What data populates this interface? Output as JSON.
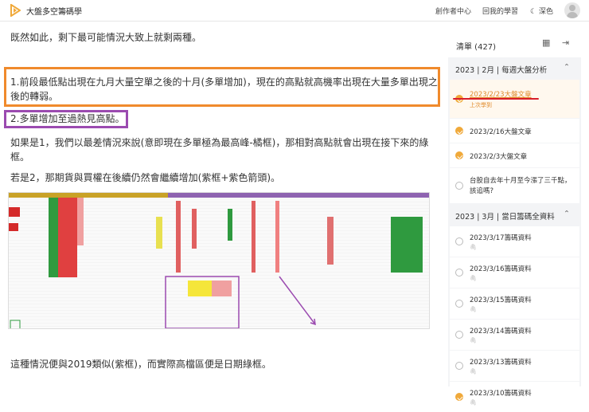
{
  "header": {
    "brand": "大盤多空籌碼學",
    "nav": [
      "創作者中心",
      "回我的學習"
    ],
    "theme_label": "深色",
    "colors": {
      "brand": "#f0a93a"
    }
  },
  "main": {
    "p1": "既然如此，剩下最可能情況大致上就剩兩種。",
    "box1": "1.前段最低點出現在九月大量空單之後的十月(多單增加)，現在的高點就高機率出現在大量多單出現之後的轉弱。",
    "box2": "2.多單增加至過熱見高點。",
    "p2": "如果是1，我們以最差情況來說(意即現在多單極為最高峰-橘框)，那相對高點就會出現在接下來的綠框。",
    "p3": "若是2，那期貨與買權在後續仍然會繼續增加(紫框+紫色箭頭)。",
    "p4": "這種情況便與2019類似(紫框)，而實際高檔區便是日期綠框。"
  },
  "sidebar": {
    "title": "清單 (427)",
    "sections": [
      {
        "label": "2023 | 2月 | 每週大盤分析",
        "items": [
          {
            "title": "2023/2/23大盤文章",
            "sub": "上次學到",
            "done": true,
            "current": true
          },
          {
            "title": "2023/2/16大盤文章",
            "done": true
          },
          {
            "title": "2023/2/3大盤文章",
            "done": true
          },
          {
            "title": "台股自去年十月至今漲了三千點，該追嗎?",
            "done": false
          }
        ]
      },
      {
        "label": "2023 | 3月 | 當日籌碼全資料",
        "items": [
          {
            "title": "2023/3/17籌碼資料",
            "done": false
          },
          {
            "title": "2023/3/16籌碼資料",
            "done": false
          },
          {
            "title": "2023/3/15籌碼資料",
            "done": false
          },
          {
            "title": "2023/3/14籌碼資料",
            "done": false
          },
          {
            "title": "2023/3/13籌碼資料",
            "done": false
          },
          {
            "title": "2023/3/10籌碼資料",
            "done": true
          }
        ]
      }
    ]
  }
}
